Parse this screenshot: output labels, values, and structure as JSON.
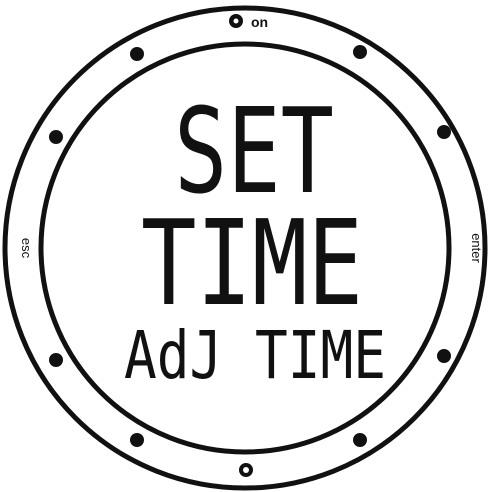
{
  "colors": {
    "ink": "#111111",
    "background": "#ffffff"
  },
  "bezel": {
    "top_button_icon": "light-bulb-icon",
    "top_button_label": "on",
    "left_button_label": "esc",
    "right_button_label": "enter",
    "bottom_button_icon": "ring-icon"
  },
  "display": {
    "line1": "SET",
    "line2": "TIME",
    "line3": "AdJ TIME"
  }
}
